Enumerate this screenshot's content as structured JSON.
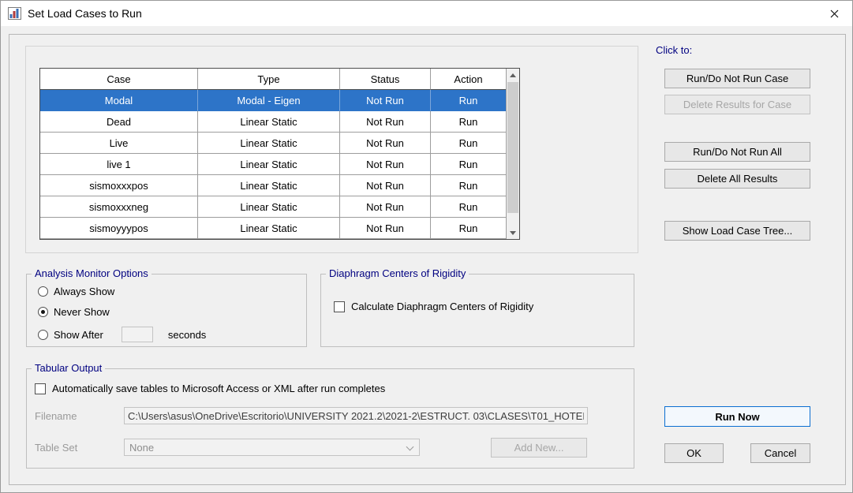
{
  "window": {
    "title": "Set Load Cases to Run"
  },
  "colors": {
    "selection": "#2d74c8",
    "accent": "#0078d7",
    "group_title": "#000080"
  },
  "icons": {
    "app_icon": "chart-document",
    "close": "x-glyph",
    "scroll_up": "triangle-up",
    "scroll_down": "triangle-down",
    "dropdown": "chevron-down"
  },
  "table": {
    "columns": [
      "Case",
      "Type",
      "Status",
      "Action"
    ],
    "rows": [
      {
        "case": "Modal",
        "type": "Modal - Eigen",
        "status": "Not Run",
        "action": "Run",
        "selected": true
      },
      {
        "case": "Dead",
        "type": "Linear Static",
        "status": "Not Run",
        "action": "Run",
        "selected": false
      },
      {
        "case": "Live",
        "type": "Linear Static",
        "status": "Not Run",
        "action": "Run",
        "selected": false
      },
      {
        "case": "live 1",
        "type": "Linear Static",
        "status": "Not Run",
        "action": "Run",
        "selected": false
      },
      {
        "case": "sismoxxxpos",
        "type": "Linear Static",
        "status": "Not Run",
        "action": "Run",
        "selected": false
      },
      {
        "case": "sismoxxxneg",
        "type": "Linear Static",
        "status": "Not Run",
        "action": "Run",
        "selected": false
      },
      {
        "case": "sismoyyypos",
        "type": "Linear Static",
        "status": "Not Run",
        "action": "Run",
        "selected": false
      }
    ]
  },
  "click_to": {
    "label": "Click to:",
    "buttons": [
      {
        "label": "Run/Do Not Run Case",
        "enabled": true
      },
      {
        "label": "Delete Results for Case",
        "enabled": false
      },
      {
        "label": "Run/Do Not Run All",
        "enabled": true
      },
      {
        "label": "Delete All Results",
        "enabled": true
      },
      {
        "label": "Show Load Case Tree...",
        "enabled": true
      }
    ]
  },
  "analysis_monitor": {
    "title": "Analysis Monitor Options",
    "options": [
      "Always Show",
      "Never Show",
      "Show After"
    ],
    "selected": "Never Show",
    "seconds_value": "",
    "seconds_label": "seconds"
  },
  "diaphragm": {
    "title": "Diaphragm Centers of Rigidity",
    "checkbox_label": "Calculate Diaphragm Centers of Rigidity",
    "checked": false
  },
  "tabular_output": {
    "title": "Tabular Output",
    "checkbox_label": "Automatically save tables to Microsoft Access or XML after run completes",
    "checked": false,
    "filename_label": "Filename",
    "filename_value": "C:\\Users\\asus\\OneDrive\\Escritorio\\UNIVERSITY 2021.2\\2021-2\\ESTRUCT. 03\\CLASES\\T01_HOTEI",
    "table_set_label": "Table Set",
    "table_set_value": "None",
    "add_new_label": "Add New..."
  },
  "footer": {
    "run_now": "Run Now",
    "ok": "OK",
    "cancel": "Cancel"
  }
}
